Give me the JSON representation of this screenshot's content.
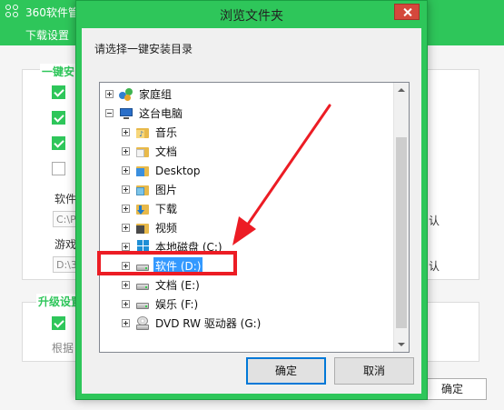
{
  "app": {
    "title": "360软件管",
    "menu_item": "下载设置"
  },
  "settings": {
    "section_install_label": "一键安",
    "section_upgrade_label": "升级设置",
    "software_label": "软件",
    "game_label": "游戏",
    "software_path": "C:\\P",
    "game_path": "D:\\3",
    "default_suffix_1": "认",
    "default_suffix_2": "认",
    "hint": "根据",
    "ok_label": "确定"
  },
  "dialog": {
    "title": "浏览文件夹",
    "instruction": "请选择一键安装目录",
    "ok_label": "确定",
    "cancel_label": "取消",
    "tree": [
      {
        "label": "家庭组",
        "icon": "homegroup-icon"
      },
      {
        "label": "这台电脑",
        "icon": "computer-icon"
      },
      {
        "label": "音乐",
        "icon": "music-folder-icon"
      },
      {
        "label": "文档",
        "icon": "documents-folder-icon"
      },
      {
        "label": "Desktop",
        "icon": "desktop-folder-icon"
      },
      {
        "label": "图片",
        "icon": "pictures-folder-icon"
      },
      {
        "label": "下载",
        "icon": "downloads-folder-icon"
      },
      {
        "label": "视频",
        "icon": "videos-folder-icon"
      },
      {
        "label": "本地磁盘 (C:)",
        "icon": "system-drive-icon"
      },
      {
        "label": "软件 (D:)",
        "icon": "drive-icon"
      },
      {
        "label": "文档 (E:)",
        "icon": "drive-icon"
      },
      {
        "label": "娱乐 (F:)",
        "icon": "drive-icon"
      },
      {
        "label": "DVD RW 驱动器 (G:)",
        "icon": "dvd-drive-icon"
      }
    ],
    "selected_item": "软件 (D:)"
  },
  "colors": {
    "brand_green": "#2ec65a",
    "selection_blue": "#3399ff",
    "annotation_red": "#ec1c24"
  }
}
